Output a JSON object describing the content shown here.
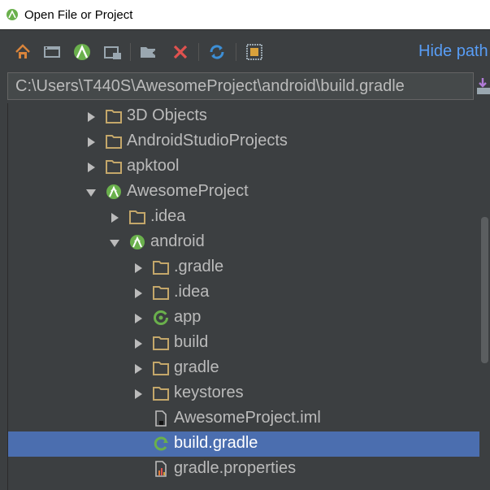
{
  "window": {
    "title": "Open File or Project"
  },
  "toolbar": {
    "buttons": [
      {
        "name": "home-icon"
      },
      {
        "name": "desktop-icon"
      },
      {
        "name": "android-project-icon"
      },
      {
        "name": "module-folder-icon"
      },
      {
        "name": "new-folder-icon"
      },
      {
        "name": "delete-icon"
      },
      {
        "name": "refresh-icon"
      },
      {
        "name": "show-hidden-icon"
      }
    ],
    "hide_path_label": "Hide path"
  },
  "path": {
    "value": "C:\\Users\\T440S\\AwesomeProject\\android\\build.gradle"
  },
  "tree": [
    {
      "label": "3D Objects",
      "icon": "folder-icon",
      "arrow": "collapsed",
      "level": 0
    },
    {
      "label": "AndroidStudioProjects",
      "icon": "folder-icon",
      "arrow": "collapsed",
      "level": 0
    },
    {
      "label": "apktool",
      "icon": "folder-icon",
      "arrow": "collapsed",
      "level": 0
    },
    {
      "label": "AwesomeProject",
      "icon": "android-icon",
      "arrow": "expanded",
      "level": 0
    },
    {
      "label": ".idea",
      "icon": "folder-icon",
      "arrow": "collapsed",
      "level": 1
    },
    {
      "label": "android",
      "icon": "android-icon",
      "arrow": "expanded",
      "level": 1
    },
    {
      "label": ".gradle",
      "icon": "folder-icon",
      "arrow": "collapsed",
      "level": 2
    },
    {
      "label": ".idea",
      "icon": "folder-icon",
      "arrow": "collapsed",
      "level": 2
    },
    {
      "label": "app",
      "icon": "module-icon",
      "arrow": "collapsed",
      "level": 2
    },
    {
      "label": "build",
      "icon": "folder-icon",
      "arrow": "collapsed",
      "level": 2
    },
    {
      "label": "gradle",
      "icon": "folder-icon",
      "arrow": "collapsed",
      "level": 2
    },
    {
      "label": "keystores",
      "icon": "folder-icon",
      "arrow": "collapsed",
      "level": 2
    },
    {
      "label": "AwesomeProject.iml",
      "icon": "iml-file-icon",
      "arrow": "none",
      "level": 2
    },
    {
      "label": "build.gradle",
      "icon": "gradle-file-icon",
      "arrow": "none",
      "level": 2,
      "selected": true
    },
    {
      "label": "gradle.properties",
      "icon": "properties-file-icon",
      "arrow": "none",
      "level": 2
    }
  ],
  "colors": {
    "background": "#3c3f41",
    "selection": "#4b6eaf",
    "link": "#589df6",
    "folder": "#c4a76a",
    "android_green": "#a4c639"
  }
}
